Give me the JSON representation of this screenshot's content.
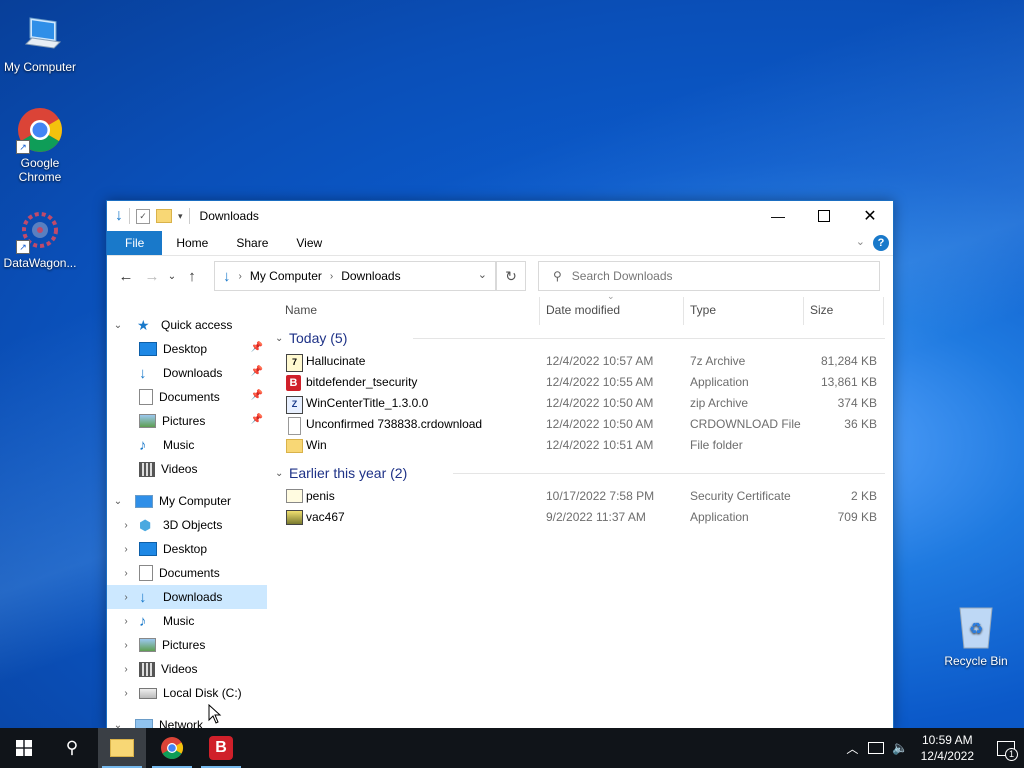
{
  "desktop": {
    "icons": [
      {
        "label": "My Computer"
      },
      {
        "label": "Google Chrome"
      },
      {
        "label": "DataWagon..."
      }
    ],
    "recycle_bin": "Recycle Bin"
  },
  "window": {
    "title": "Downloads",
    "ribbon_tabs": [
      "File",
      "Home",
      "Share",
      "View"
    ],
    "address": {
      "crumbs": [
        "My Computer",
        "Downloads"
      ]
    },
    "search_placeholder": "Search Downloads",
    "columns": {
      "name": "Name",
      "date": "Date modified",
      "type": "Type",
      "size": "Size"
    },
    "nav_pane": {
      "quick_access": {
        "label": "Quick access",
        "items": [
          "Desktop",
          "Downloads",
          "Documents",
          "Pictures",
          "Music",
          "Videos"
        ]
      },
      "my_computer": {
        "label": "My Computer",
        "items": [
          "3D Objects",
          "Desktop",
          "Documents",
          "Downloads",
          "Music",
          "Pictures",
          "Videos",
          "Local Disk (C:)"
        ]
      },
      "network": "Network"
    },
    "groups": [
      {
        "label": "Today (5)",
        "files": [
          {
            "name": "Hallucinate",
            "date": "12/4/2022 10:57 AM",
            "type": "7z Archive",
            "size": "81,284 KB",
            "icon": "archive-icon"
          },
          {
            "name": "bitdefender_tsecurity",
            "date": "12/4/2022 10:55 AM",
            "type": "Application",
            "size": "13,861 KB",
            "icon": "bitdefender-icon"
          },
          {
            "name": "WinCenterTitle_1.3.0.0",
            "date": "12/4/2022 10:50 AM",
            "type": "zip Archive",
            "size": "374 KB",
            "icon": "zip-icon"
          },
          {
            "name": "Unconfirmed 738838.crdownload",
            "date": "12/4/2022 10:50 AM",
            "type": "CRDOWNLOAD File",
            "size": "36 KB",
            "icon": "blank-file-icon"
          },
          {
            "name": "Win",
            "date": "12/4/2022 10:51 AM",
            "type": "File folder",
            "size": "",
            "icon": "folder-icon"
          }
        ]
      },
      {
        "label": "Earlier this year (2)",
        "files": [
          {
            "name": "penis",
            "date": "10/17/2022 7:58 PM",
            "type": "Security Certificate",
            "size": "2 KB",
            "icon": "certificate-icon"
          },
          {
            "name": "vac467",
            "date": "9/2/2022 11:37 AM",
            "type": "Application",
            "size": "709 KB",
            "icon": "app-icon"
          }
        ]
      }
    ]
  },
  "taskbar": {
    "time": "10:59 AM",
    "date": "12/4/2022",
    "notification_count": "1"
  },
  "colors": {
    "accent": "#1979ca",
    "selection": "#cce8ff",
    "group_header": "#1e3287",
    "taskbar": "#101419"
  }
}
